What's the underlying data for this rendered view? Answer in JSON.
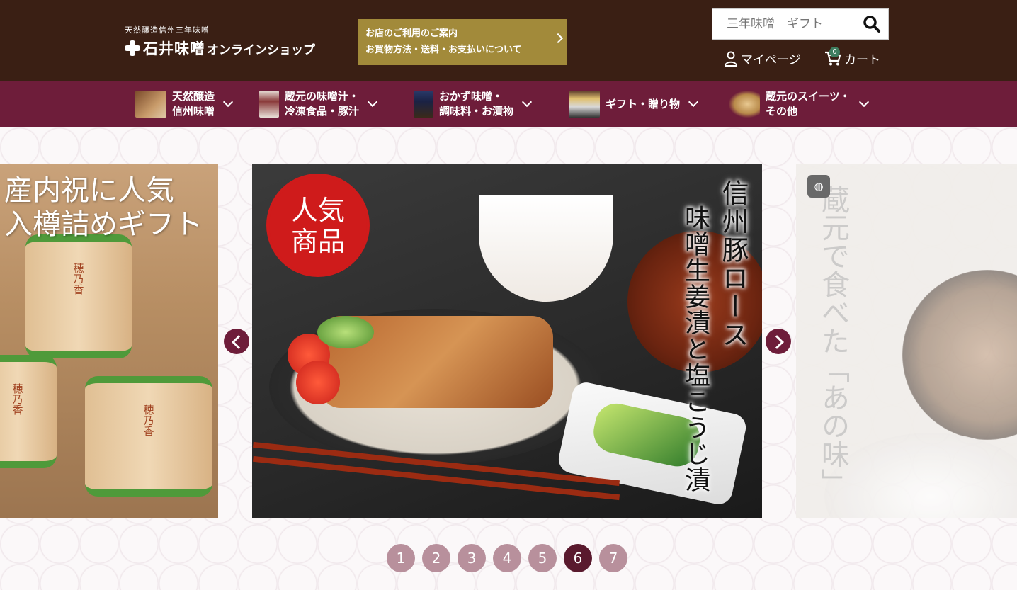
{
  "header": {
    "logo_small": "天然醸造信州三年味噌",
    "logo_name": "石井味噌",
    "logo_shop": "オンラインショップ",
    "info_line1": "お店のご利用のご案内",
    "info_line2": "お買物方法・送料・お支払いについて",
    "search_placeholder": "三年味噌　ギフト",
    "mypage_label": "マイページ",
    "cart_label": "カート",
    "cart_count": "0"
  },
  "nav": {
    "items": [
      {
        "line1": "天然醸造",
        "line2": "信州味噌"
      },
      {
        "line1": "蔵元の味噌汁・",
        "line2": "冷凍食品・豚汁"
      },
      {
        "line1": "おかず味噌・",
        "line2": "調味料・お漬物"
      },
      {
        "line1": "ギフト・贈り物",
        "line2": ""
      },
      {
        "line1": "蔵元のスイーツ・",
        "line2": "その他"
      }
    ]
  },
  "carousel": {
    "left_text_line1": "産内祝に人気",
    "left_text_line2": "入樽詰めギフト",
    "barrel_label": "穂乃香",
    "badge_line1": "人気",
    "badge_line2": "商品",
    "center_col1": "信州豚ロース",
    "center_col2": "味噌生姜漬と塩こうじ漬",
    "right_text": "蔵元で食べた「あの味」",
    "pages": [
      "1",
      "2",
      "3",
      "4",
      "5",
      "6",
      "7"
    ],
    "active_page": "6"
  },
  "colors": {
    "header_bg": "#3a1f14",
    "nav_bg": "#6e1d3a",
    "info_bg": "#a28a3a",
    "dot_inactive": "#b8909c",
    "dot_active": "#5a1a2e",
    "badge_red": "#cf1b1b"
  }
}
